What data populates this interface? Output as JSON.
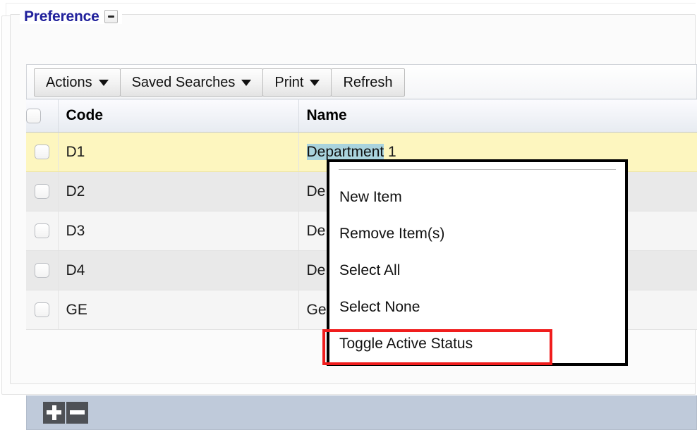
{
  "section": {
    "title": "Preference",
    "collapse_icon": "minus-icon"
  },
  "toolbar": {
    "buttons": [
      {
        "label": "Actions",
        "has_caret": true,
        "icon": "chevron-down-icon"
      },
      {
        "label": "Saved Searches",
        "has_caret": true,
        "icon": "chevron-down-icon"
      },
      {
        "label": "Print",
        "has_caret": true,
        "icon": "chevron-down-icon"
      },
      {
        "label": "Refresh",
        "has_caret": false,
        "icon": ""
      }
    ]
  },
  "table": {
    "columns": [
      {
        "key": "checkbox",
        "label": ""
      },
      {
        "key": "code",
        "label": "Code"
      },
      {
        "key": "name",
        "label": "Name"
      }
    ],
    "rows": [
      {
        "code": "D1",
        "name_selected": "Department",
        "name_rest": " 1",
        "state": "selected"
      },
      {
        "code": "D2",
        "name_visible": "De",
        "state": "alt"
      },
      {
        "code": "D3",
        "name_visible": "De",
        "state": "plain"
      },
      {
        "code": "D4",
        "name_visible": "De",
        "state": "alt"
      },
      {
        "code": "GE",
        "name_visible": "Ge",
        "state": "plain"
      }
    ]
  },
  "footer": {
    "add_icon": "plus-icon",
    "remove_icon": "minus-icon"
  },
  "context_menu": {
    "items": [
      {
        "label": "New Item",
        "highlighted": false
      },
      {
        "label": "Remove Item(s)",
        "highlighted": false
      },
      {
        "label": "Select All",
        "highlighted": false
      },
      {
        "label": "Select None",
        "highlighted": false
      },
      {
        "label": "Toggle Active Status",
        "highlighted": true
      }
    ]
  },
  "colors": {
    "legend_text": "#21219c",
    "selected_row": "#fdf6bf",
    "footer_bar": "#bfcada",
    "text_selection": "#a9d3dd",
    "highlight_border": "#f01d1d",
    "menu_border": "#000000"
  }
}
